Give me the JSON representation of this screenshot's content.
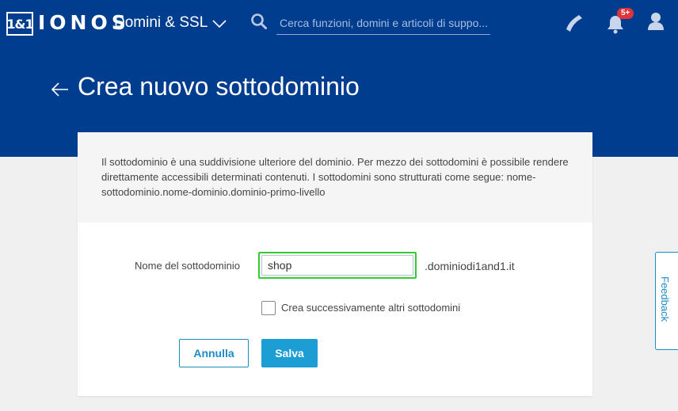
{
  "topbar": {
    "logo_mark": "1&1",
    "logo_text": "IONOS",
    "nav_menu_label": "Domini & SSL",
    "search_placeholder": "Cerca funzioni, domini e articoli di suppo...",
    "notification_badge": "5+"
  },
  "header": {
    "title": "Crea nuovo sottodominio"
  },
  "card": {
    "info_text": "Il sottodominio è una suddivisione ulteriore del dominio. Per mezzo dei sottodomini è possibile rendere direttamente accessibili determinati contenuti. I sottodomini sono strutturati come segue: nome-sottodominio.nome-dominio.dominio-primo-livello",
    "field_label": "Nome del sottodominio",
    "field_value": "shop",
    "domain_suffix": ".dominiodi1and1.it",
    "checkbox_label": "Crea successivamente altri sottodomini",
    "cancel_label": "Annulla",
    "save_label": "Salva"
  },
  "feedback": {
    "label": "Feedback"
  },
  "colors": {
    "brand_blue": "#003d8f",
    "accent_blue": "#1c9dd3",
    "focus_green": "#33cc33",
    "badge_red": "#e0333a"
  }
}
